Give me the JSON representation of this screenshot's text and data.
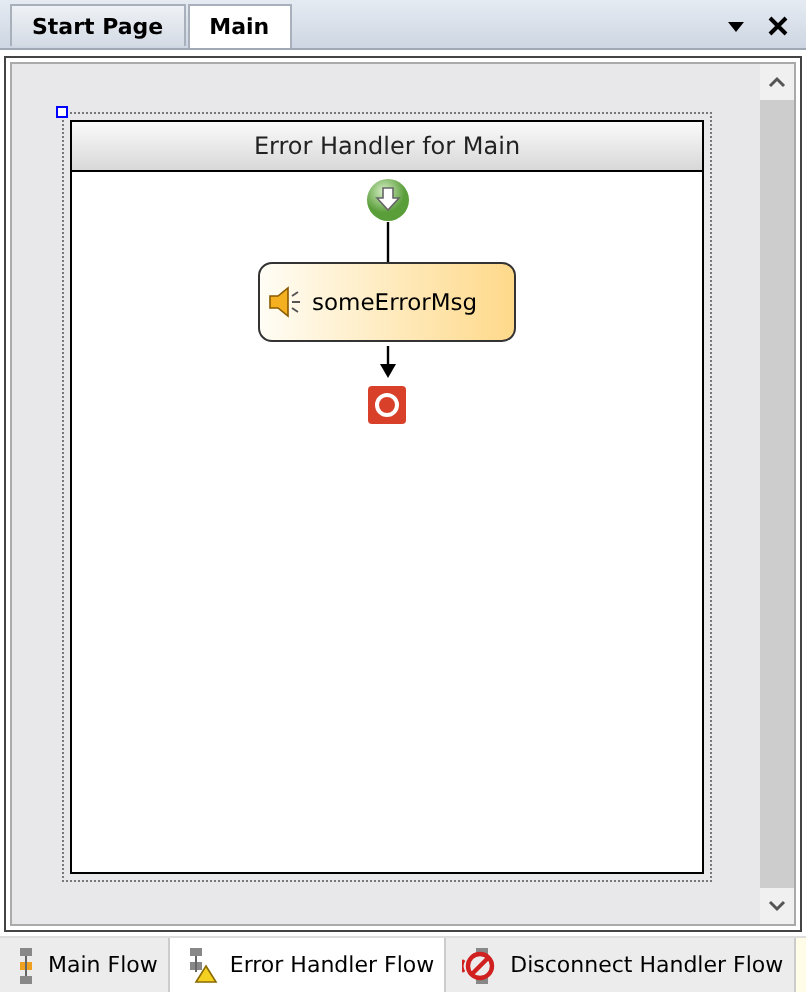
{
  "doc_tabs": [
    {
      "label": "Start Page",
      "selected": false
    },
    {
      "label": "Main",
      "selected": true
    }
  ],
  "handler": {
    "title": "Error Handler for Main"
  },
  "flow": [
    {
      "kind": "start"
    },
    {
      "kind": "activity",
      "label": "someErrorMsg"
    },
    {
      "kind": "end"
    }
  ],
  "flow_tabs": [
    {
      "label": "Main Flow",
      "kind": "main",
      "selected": false
    },
    {
      "label": "Error Handler Flow",
      "kind": "error",
      "selected": true
    },
    {
      "label": "Disconnect Handler Flow",
      "kind": "disconnect",
      "selected": false
    }
  ]
}
